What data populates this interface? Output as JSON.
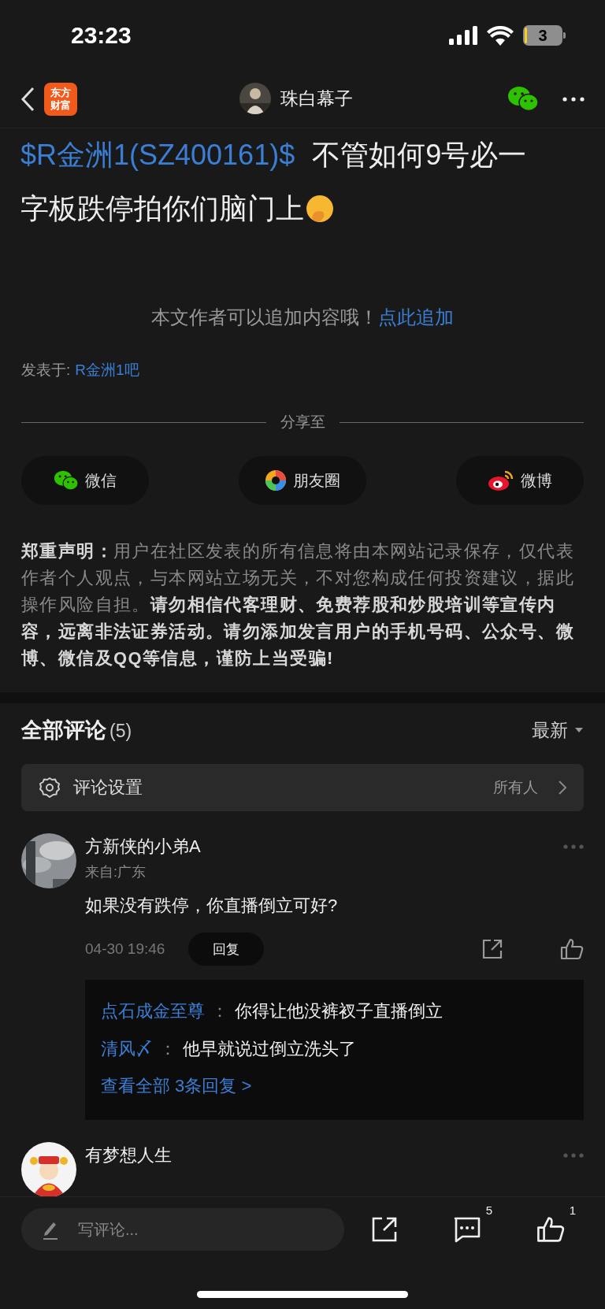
{
  "status_bar": {
    "time": "23:23",
    "battery": "3"
  },
  "nav": {
    "logo_text": [
      "东方",
      "财富"
    ],
    "author": "珠白幕子"
  },
  "post": {
    "stock_tag": "$R金洲1(SZ400161)$",
    "text_lines": [
      "不管如何9号必一",
      "字板跌停拍你们脑门上"
    ],
    "append_hint": "本文作者可以追加内容哦！",
    "append_link": "点此追加",
    "posted_in_label": "发表于:",
    "posted_in": "R金洲1吧"
  },
  "share": {
    "title": "分享至",
    "targets": [
      {
        "kind": "wechat",
        "label": "微信"
      },
      {
        "kind": "moments",
        "label": "朋友圈"
      },
      {
        "kind": "weibo",
        "label": "微博"
      }
    ]
  },
  "disclaimer": "**郑重声明：**用户在社区发表的所有信息将由本网站记录保存，仅代表作者个人观点，与本网站立场无关，不对您构成任何投资建议，据此操作风险自担。**请勿相信代客理财、免费荐股和炒股培训等宣传内容，远离非法证券活动。请勿添加发言用户的手机号码、公众号、微博、微信及QQ等信息，谨防上当受骗!**",
  "comments": {
    "title": "全部评论",
    "count": "(5)",
    "sort": "最新",
    "settings": {
      "label": "评论设置",
      "value": "所有人"
    },
    "items": [
      {
        "name": "方新侠的小弟A",
        "location": "来自:广东",
        "text": "如果没有跌停，你直播倒立可好?",
        "time": "04-30 19:46",
        "reply_label": "回复",
        "replies": [
          {
            "author": "点石成金至尊",
            "separator": "：",
            "text": "你得让他没裤衩子直播倒立"
          },
          {
            "author": "清风〆",
            "separator": "：",
            "text": "他早就说过倒立洗头了"
          }
        ],
        "more_replies": "查看全部 3条回复 >"
      },
      {
        "name": "有梦想人生"
      }
    ]
  },
  "bottom_bar": {
    "placeholder": "写评论...",
    "comment_count": "5",
    "like_count": "1"
  }
}
